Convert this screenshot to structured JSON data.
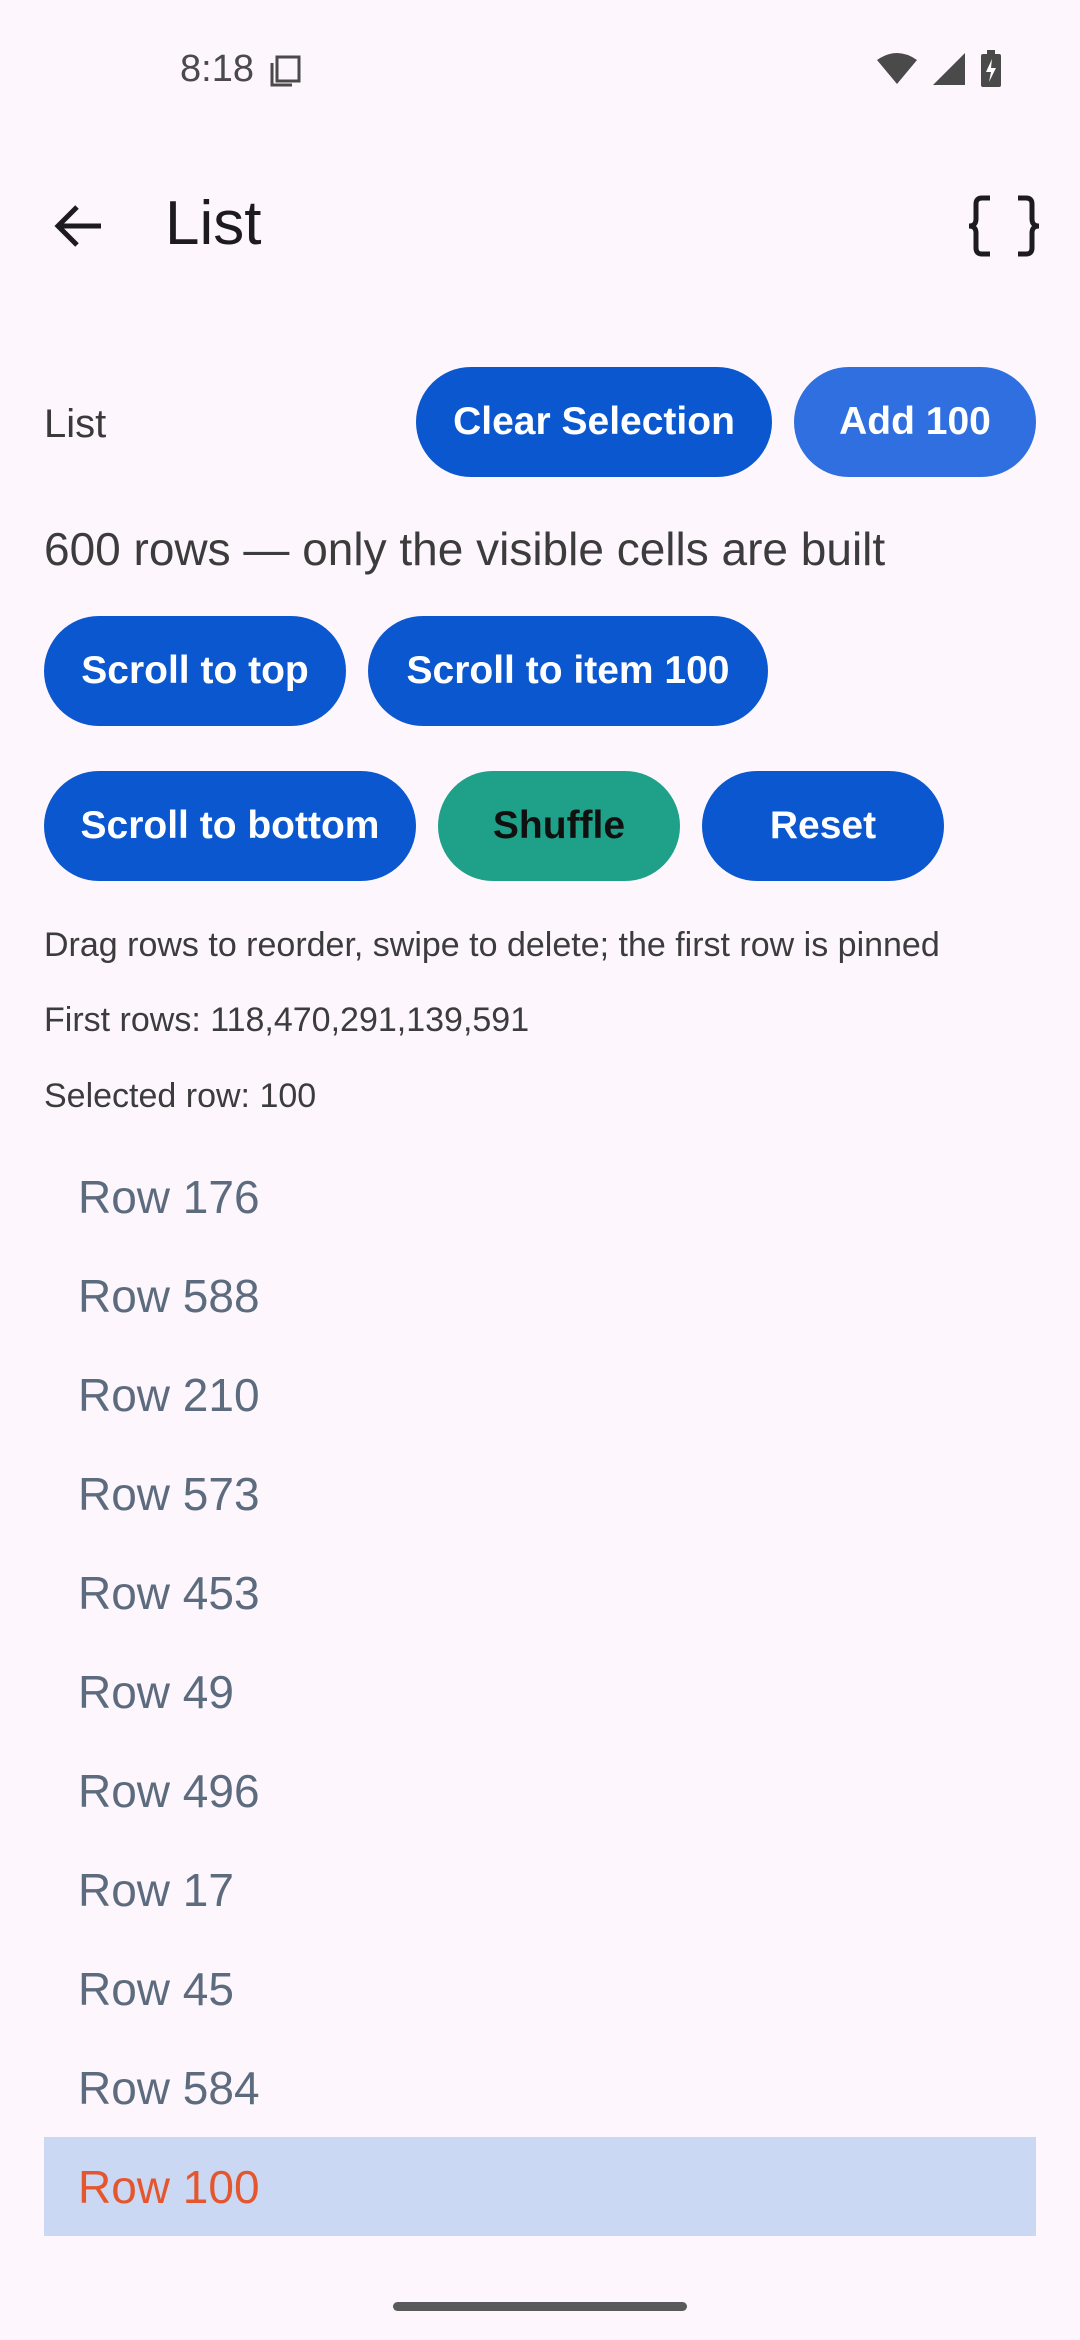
{
  "status_bar": {
    "time": "8:18"
  },
  "app_bar": {
    "title": "List"
  },
  "header": {
    "label": "List",
    "clear_selection_label": "Clear Selection",
    "add_100_label": "Add 100"
  },
  "info": {
    "rows_text": "600 rows — only the visible cells are built"
  },
  "actions": {
    "scroll_top_label": "Scroll to top",
    "scroll_item_label": "Scroll to item 100",
    "scroll_bottom_label": "Scroll to bottom",
    "shuffle_label": "Shuffle",
    "reset_label": "Reset"
  },
  "hints": {
    "drag_hint": "Drag rows to reorder, swipe to delete; the first row is pinned",
    "first_rows": "First rows: 118,470,291,139,591",
    "selected_row": "Selected row: 100"
  },
  "rows": [
    {
      "label": "Row 176"
    },
    {
      "label": "Row 588"
    },
    {
      "label": "Row 210"
    },
    {
      "label": "Row 573"
    },
    {
      "label": "Row 453"
    },
    {
      "label": "Row 49"
    },
    {
      "label": "Row 496"
    },
    {
      "label": "Row 17"
    },
    {
      "label": "Row 45"
    },
    {
      "label": "Row 584"
    },
    {
      "label": "Row 100",
      "selected": true
    }
  ],
  "colors": {
    "background": "#fdf7fd",
    "primary": "#0b57d0",
    "teal": "#1fa088",
    "selected_row_bg": "#cbd8f4",
    "selected_row_text": "#e4572e",
    "row_text": "#5d6b7e"
  },
  "icons": {
    "back": "arrow-back-icon",
    "code": "curly-braces-icon",
    "notification": "copy-notification-icon",
    "wifi": "wifi-icon",
    "signal": "cell-signal-icon",
    "battery": "battery-charging-icon"
  }
}
